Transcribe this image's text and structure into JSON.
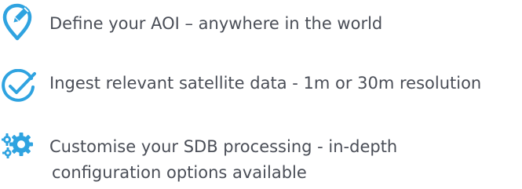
{
  "accent_color": "#2fa3e0",
  "text_color": "#4a4e57",
  "features": [
    {
      "icon": "pin-pencil-icon",
      "lines": [
        "Define your AOI – anywhere in the world"
      ]
    },
    {
      "icon": "check-circle-icon",
      "lines": [
        "Ingest relevant satellite data - 1m or 30m resolution"
      ]
    },
    {
      "icon": "gears-icon",
      "lines": [
        "Customise your SDB processing - in-depth",
        "configuration options available"
      ]
    }
  ]
}
